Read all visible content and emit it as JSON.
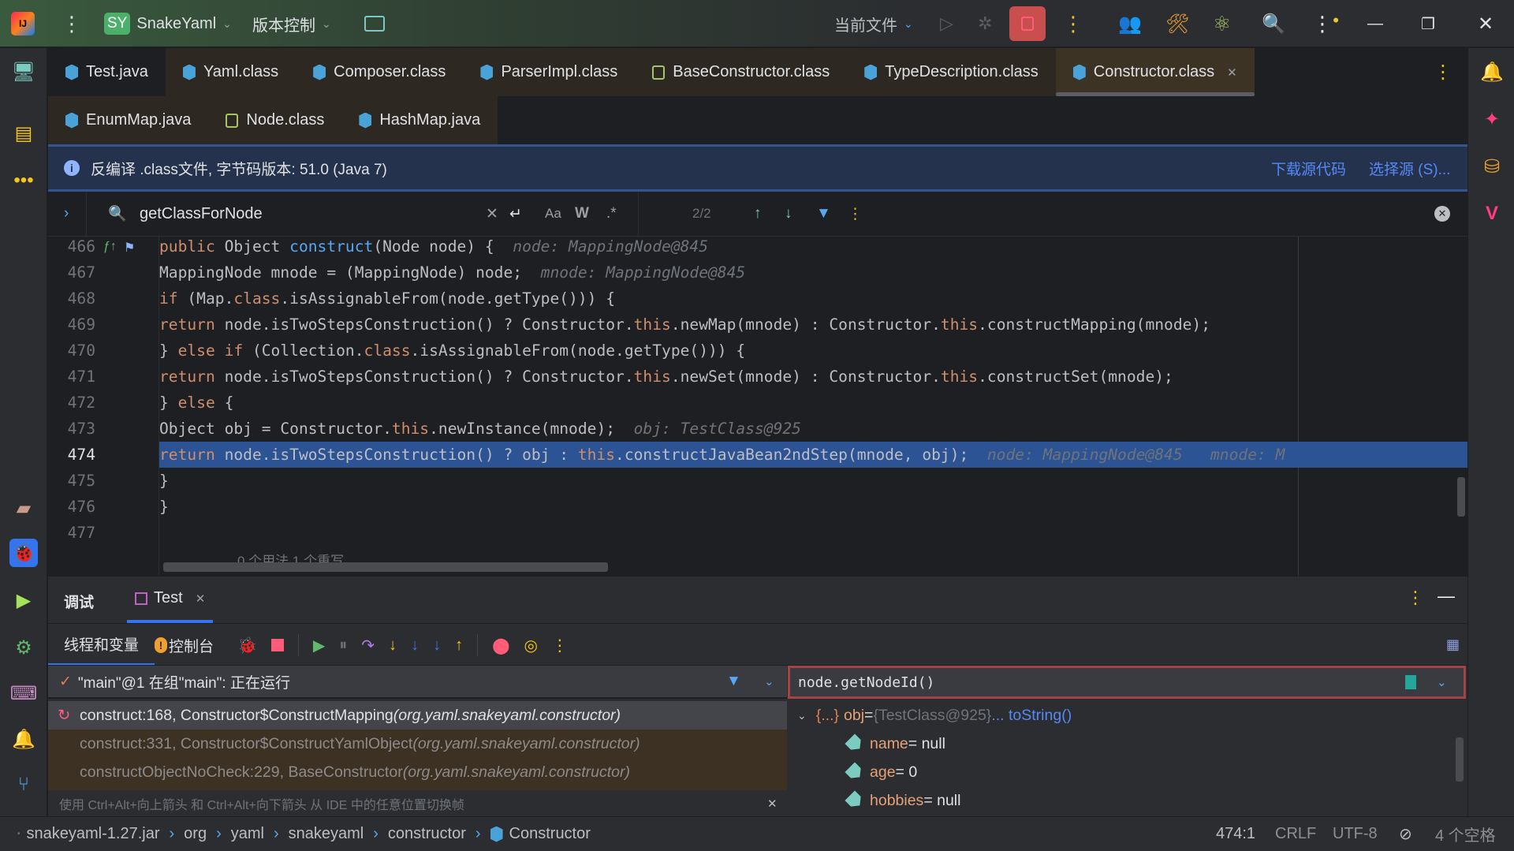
{
  "titlebar": {
    "project_badge": "SY",
    "project_name": "SnakeYaml",
    "vcs_label": "版本控制",
    "run_config": "当前文件"
  },
  "tabs_row1": [
    {
      "label": "Test.java",
      "icon": "java-file-icon"
    },
    {
      "label": "Yaml.class",
      "icon": "class-file-icon"
    },
    {
      "label": "Composer.class",
      "icon": "class-file-icon"
    },
    {
      "label": "ParserImpl.class",
      "icon": "class-file-icon"
    },
    {
      "label": "BaseConstructor.class",
      "icon": "abstract-class-icon"
    },
    {
      "label": "TypeDescription.class",
      "icon": "class-file-icon"
    },
    {
      "label": "Constructor.class",
      "icon": "class-file-icon",
      "active": true
    }
  ],
  "tabs_row2": [
    {
      "label": "EnumMap.java",
      "icon": "class-file-icon"
    },
    {
      "label": "Node.class",
      "icon": "abstract-class-icon"
    },
    {
      "label": "HashMap.java",
      "icon": "class-file-icon"
    }
  ],
  "banner": {
    "text": "反编译 .class文件, 字节码版本: 51.0 (Java 7)",
    "download_link": "下载源代码",
    "choose_link": "选择源 (S)..."
  },
  "find": {
    "query": "getClassForNode",
    "match_case": "Aa",
    "words": "W",
    "regex": ".*",
    "count": "2/2"
  },
  "code": {
    "highlight_line": 474,
    "lines": [
      {
        "n": "466",
        "indent": 8,
        "tokens": [
          [
            "kw",
            "public "
          ],
          [
            "pl",
            "Object "
          ],
          [
            "fn",
            "construct"
          ],
          [
            "pl",
            "(Node node) {  "
          ],
          [
            "hint",
            "node: MappingNode@845"
          ]
        ]
      },
      {
        "n": "467",
        "indent": 12,
        "tokens": [
          [
            "pl",
            "MappingNode mnode = (MappingNode) node;  "
          ],
          [
            "hint",
            "mnode: MappingNode@845"
          ]
        ]
      },
      {
        "n": "468",
        "indent": 12,
        "tokens": [
          [
            "kw",
            "if "
          ],
          [
            "pl",
            "(Map."
          ],
          [
            "kw",
            "class"
          ],
          [
            "pl",
            ".isAssignableFrom(node.getType())) {"
          ]
        ]
      },
      {
        "n": "469",
        "indent": 16,
        "tokens": [
          [
            "kw",
            "return "
          ],
          [
            "pl",
            "node.isTwoStepsConstruction() ? Constructor."
          ],
          [
            "kw",
            "this"
          ],
          [
            "pl",
            ".newMap(mnode) : Constructor."
          ],
          [
            "kw",
            "this"
          ],
          [
            "pl",
            ".constructMapping(mnode);"
          ]
        ]
      },
      {
        "n": "470",
        "indent": 12,
        "tokens": [
          [
            "pl",
            "} "
          ],
          [
            "kw",
            "else if "
          ],
          [
            "pl",
            "(Collection."
          ],
          [
            "kw",
            "class"
          ],
          [
            "pl",
            ".isAssignableFrom(node.getType())) {"
          ]
        ]
      },
      {
        "n": "471",
        "indent": 16,
        "tokens": [
          [
            "kw",
            "return "
          ],
          [
            "pl",
            "node.isTwoStepsConstruction() ? Constructor."
          ],
          [
            "kw",
            "this"
          ],
          [
            "pl",
            ".newSet(mnode) : Constructor."
          ],
          [
            "kw",
            "this"
          ],
          [
            "pl",
            ".constructSet(mnode);"
          ]
        ]
      },
      {
        "n": "472",
        "indent": 12,
        "tokens": [
          [
            "pl",
            "} "
          ],
          [
            "kw",
            "else "
          ],
          [
            "pl",
            "{"
          ]
        ]
      },
      {
        "n": "473",
        "indent": 16,
        "tokens": [
          [
            "pl",
            "Object obj = Constructor."
          ],
          [
            "kw",
            "this"
          ],
          [
            "pl",
            ".newInstance(mnode);  "
          ],
          [
            "hint",
            "obj: TestClass@925"
          ]
        ]
      },
      {
        "n": "474",
        "indent": 16,
        "tokens": [
          [
            "kw",
            "return "
          ],
          [
            "pl",
            "node.isTwoStepsConstruction() ? obj : "
          ],
          [
            "kw",
            "this"
          ],
          [
            "pl",
            ".constructJavaBean2ndStep(mnode, obj);  "
          ],
          [
            "hint",
            "node: MappingNode@845   mnode: M"
          ]
        ]
      },
      {
        "n": "475",
        "indent": 12,
        "tokens": [
          [
            "pl",
            "}"
          ]
        ]
      },
      {
        "n": "476",
        "indent": 8,
        "tokens": [
          [
            "pl",
            "}"
          ]
        ]
      },
      {
        "n": "477",
        "indent": 0,
        "tokens": []
      }
    ],
    "usages_hint": "0 个用法   1 个重写"
  },
  "debug": {
    "title": "调试",
    "session_tab": "Test",
    "threads_tab": "线程和变量",
    "console_tab": "控制台",
    "thread_status": "\"main\"@1 在组\"main\": 正在运行",
    "frames": [
      {
        "method": "construct:168, Constructor$ConstructMapping ",
        "pkg": "(org.yaml.snakeyaml.constructor)",
        "selected": true
      },
      {
        "method": "construct:331, Constructor$ConstructYamlObject ",
        "pkg": "(org.yaml.snakeyaml.constructor)"
      },
      {
        "method": "constructObjectNoCheck:229, BaseConstructor ",
        "pkg": "(org.yaml.snakeyaml.constructor)"
      }
    ],
    "hint": "使用 Ctrl+Alt+向上箭头 和 Ctrl+Alt+向下箭头 从 IDE 中的任意位置切换帧",
    "eval_expression": "node.getNodeId()",
    "variables": {
      "root": {
        "brace": "{...}",
        "name": "obj",
        "eq": " = ",
        "value": "{TestClass@925}",
        "link": " ... toString()"
      },
      "fields": [
        {
          "name": "name",
          "value": " = null"
        },
        {
          "name": "age",
          "value": " = 0"
        },
        {
          "name": "hobbies",
          "value": " = null"
        }
      ]
    }
  },
  "statusbar": {
    "crumbs": [
      "snakeyaml-1.27.jar",
      "org",
      "yaml",
      "snakeyaml",
      "constructor",
      "Constructor"
    ],
    "position": "474:1",
    "line_sep": "CRLF",
    "encoding": "UTF-8",
    "indent": "4 个空格"
  },
  "colors": {
    "keyword": "#cf8e6d",
    "method": "#56a8f5",
    "highlight": "#2c5393",
    "stop": "#c94f4f",
    "accent": "#3574f0"
  }
}
